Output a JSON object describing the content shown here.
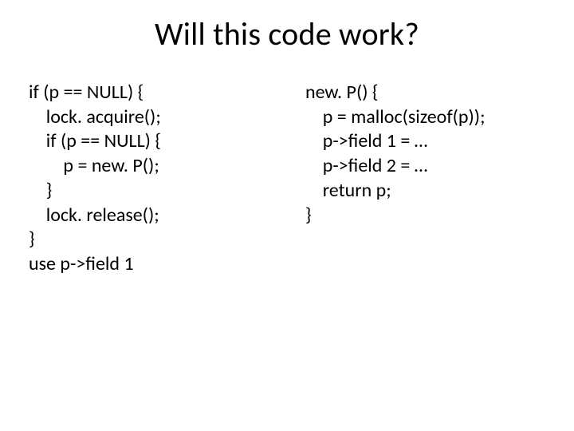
{
  "title": "Will this code work?",
  "left": {
    "l1": "if (p == NULL) {",
    "l2": "    lock. acquire();",
    "l3": "    if (p == NULL) {",
    "l4": "        p = new. P();",
    "l5": "    }",
    "l6": "    lock. release();",
    "l7": "}",
    "l8": "use p->field 1"
  },
  "right": {
    "l1": "new. P() {",
    "l2": "    p = malloc(sizeof(p));",
    "l3": "    p->field 1 = …",
    "l4": "    p->field 2 = …",
    "l5": "    return p;",
    "l6": "}"
  }
}
